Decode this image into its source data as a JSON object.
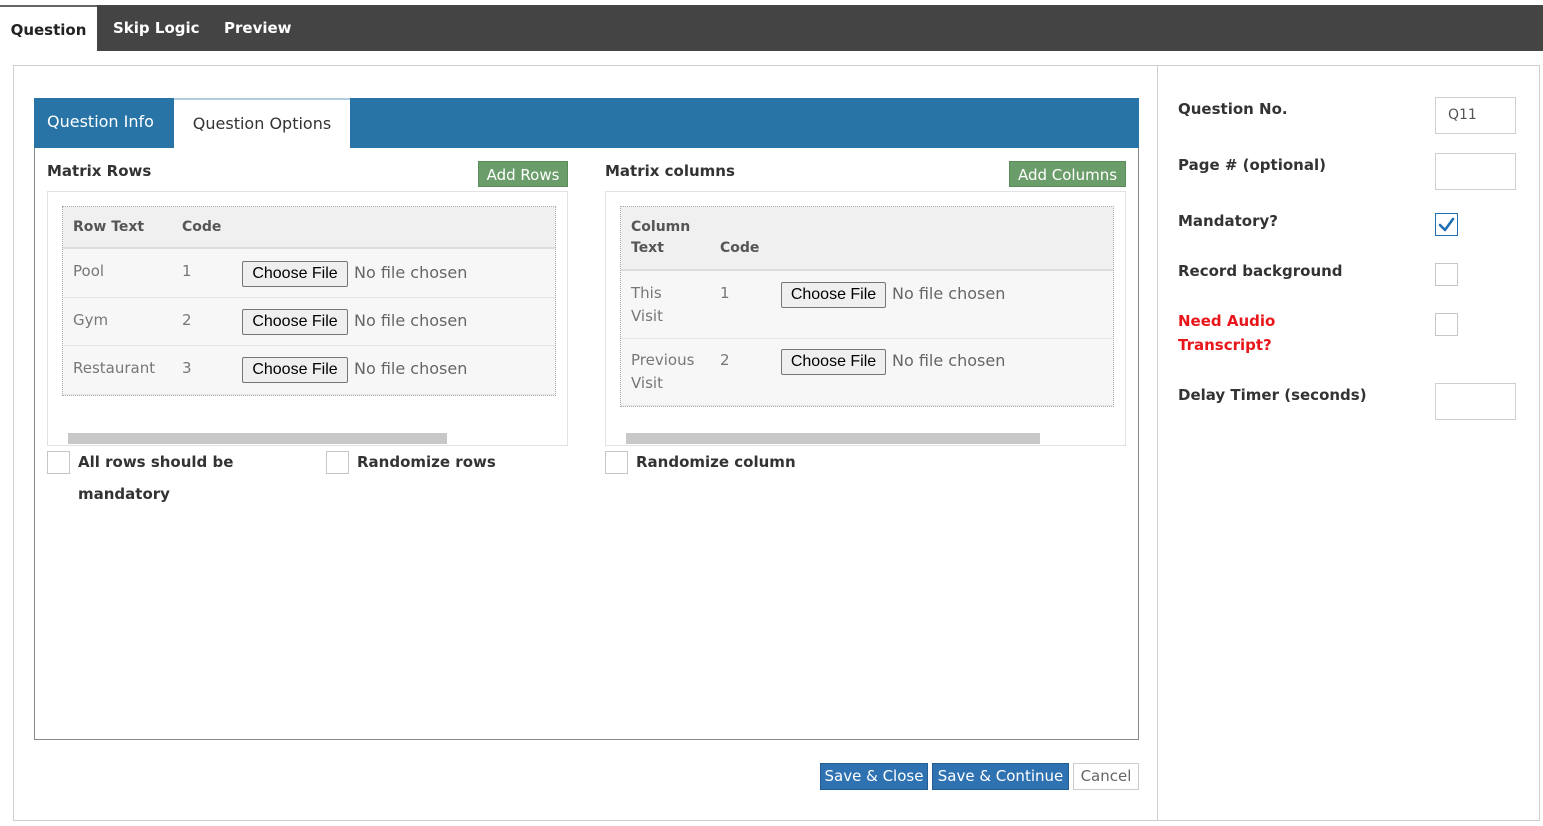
{
  "top_tabs": [
    {
      "label": "Question",
      "active": true
    },
    {
      "label": "Skip Logic",
      "active": false
    },
    {
      "label": "Preview",
      "active": false
    }
  ],
  "inner_tabs": [
    {
      "label": "Question Info",
      "active": false
    },
    {
      "label": "Question Options",
      "active": true
    }
  ],
  "matrix_rows": {
    "title": "Matrix Rows",
    "add_button": "Add Rows",
    "headers": {
      "text": "Row Text",
      "code": "Code"
    },
    "rows": [
      {
        "text": "Pool",
        "code": "1",
        "file_button": "Choose File",
        "file_status": "No file chosen"
      },
      {
        "text": "Gym",
        "code": "2",
        "file_button": "Choose File",
        "file_status": "No file chosen"
      },
      {
        "text": "Restaurant",
        "code": "3",
        "file_button": "Choose File",
        "file_status": "No file chosen"
      }
    ]
  },
  "matrix_columns": {
    "title": "Matrix columns",
    "add_button": "Add Columns",
    "headers": {
      "text_line1": "Column",
      "text_line2": "Text",
      "code": "Code"
    },
    "columns": [
      {
        "text_line1": "This",
        "text_line2": "Visit",
        "code": "1",
        "file_button": "Choose File",
        "file_status": "No file chosen"
      },
      {
        "text_line1": "Previous",
        "text_line2": "Visit",
        "code": "2",
        "file_button": "Choose File",
        "file_status": "No file chosen"
      }
    ]
  },
  "options": {
    "all_rows_mandatory_line1": "All rows should be",
    "all_rows_mandatory_line2": "mandatory",
    "randomize_rows": "Randomize rows",
    "randomize_column": "Randomize column"
  },
  "actions": {
    "save_close": "Save & Close",
    "save_continue": "Save & Continue",
    "cancel": "Cancel"
  },
  "side": {
    "question_no_label": "Question No.",
    "question_no_value": "Q11",
    "page_label": "Page # (optional)",
    "page_value": "",
    "mandatory_label": "Mandatory?",
    "mandatory_checked": true,
    "record_background_label": "Record background",
    "record_background_checked": false,
    "need_audio_line1": "Need Audio",
    "need_audio_line2": "Transcript?",
    "need_audio_checked": false,
    "delay_timer_label": "Delay Timer (seconds)",
    "delay_timer_value": ""
  },
  "colors": {
    "topbar": "#444444",
    "tabbar": "#2874a6",
    "green_button": "#6a9d6a",
    "blue_button": "#2f72b2",
    "alert_red": "#e8161b"
  }
}
